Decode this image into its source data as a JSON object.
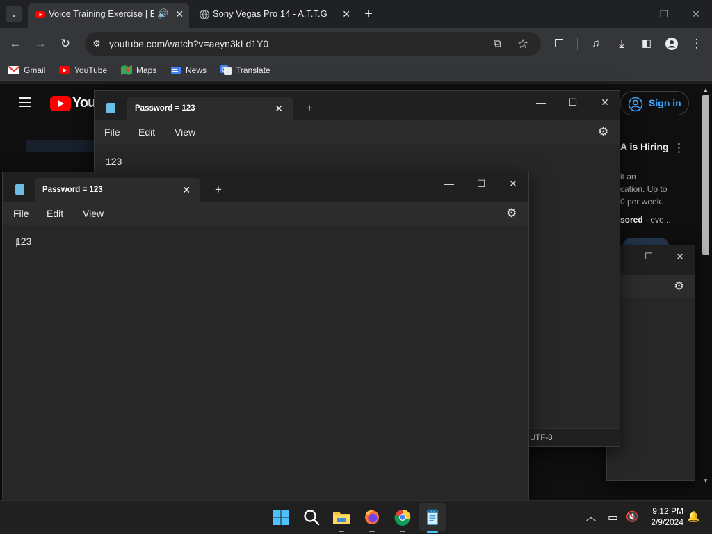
{
  "browser": {
    "tabs": [
      {
        "title": "Voice Training Exercise | Eas",
        "active": true
      },
      {
        "title": "Sony Vegas Pro 14 - A.T.T.G",
        "active": false
      }
    ],
    "new_tab_label": "+",
    "url": "youtube.com/watch?v=aeyn3kLd1Y0",
    "bookmarks": [
      "Gmail",
      "YouTube",
      "Maps",
      "News",
      "Translate"
    ]
  },
  "youtube": {
    "logo_text": "YouT",
    "sign_in_label": "Sign in",
    "ad_title": "A is Hiring",
    "ad_lines": [
      "it an",
      "cation. Up to",
      "0 per week."
    ],
    "ad_sponsored": "sored",
    "ad_sponsored_tail": " · eve..."
  },
  "notepad_back": {
    "tab_title": "Password = 123",
    "menus": [
      "File",
      "Edit",
      "View"
    ],
    "content": "123",
    "status_encoding": "UTF-8"
  },
  "notepad_front": {
    "tab_title": "Password = 123",
    "menus": [
      "File",
      "Edit",
      "View"
    ],
    "content": "123"
  },
  "taskbar": {
    "time": "9:12 PM",
    "date": "2/9/2024"
  },
  "colors": {
    "youtube_red": "#ff0000",
    "chrome_bg": "#202124",
    "notepad_accent": "#6bbde6",
    "sign_in_blue": "#3ea6ff"
  }
}
